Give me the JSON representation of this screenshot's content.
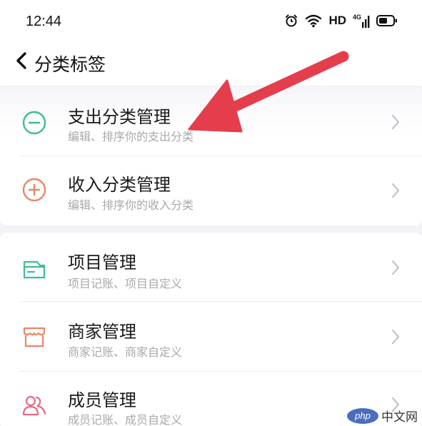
{
  "status_bar": {
    "time": "12:44",
    "network_label": "HD",
    "signal_generation": "4G",
    "icons": [
      "alarm-icon",
      "wifi-icon",
      "signal-icon",
      "battery-icon"
    ]
  },
  "nav": {
    "title": "分类标签",
    "back_icon": "chevron-left-icon"
  },
  "category_management": [
    {
      "title": "支出分类管理",
      "subtitle": "编辑、排序你的支出分类",
      "icon": "minus-circle-icon",
      "color": "#3cbf8e"
    },
    {
      "title": "收入分类管理",
      "subtitle": "编辑、排序你的收入分类",
      "icon": "plus-circle-icon",
      "color": "#e98762"
    }
  ],
  "other_management": [
    {
      "title": "项目管理",
      "subtitle": "项目记账、项目自定义",
      "icon": "folder-icon",
      "color": "#3cbf8e"
    },
    {
      "title": "商家管理",
      "subtitle": "商家记账、商家自定义",
      "icon": "shop-icon",
      "color": "#e98762"
    },
    {
      "title": "成员管理",
      "subtitle": "成员记账、成员自定义",
      "icon": "members-icon",
      "color": "#e46b82"
    }
  ],
  "annotation": {
    "color": "#e43e4c"
  },
  "watermark": {
    "logo_text": "php",
    "text": "中文网"
  }
}
